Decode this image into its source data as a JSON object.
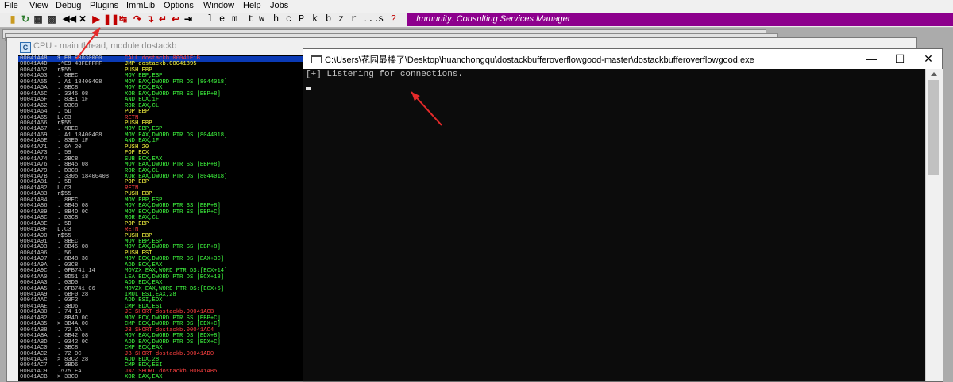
{
  "menu": [
    "File",
    "View",
    "Debug",
    "Plugins",
    "ImmLib",
    "Options",
    "Window",
    "Help",
    "Jobs"
  ],
  "toolbar": {
    "buttons": [
      "open-icon",
      "restart-icon",
      "close-program-icon",
      "window-icon",
      "rewind-icon",
      "close-icon",
      "run-icon",
      "pause-icon",
      "step-into-icon",
      "step-over-icon",
      "trace-into-icon",
      "trace-over-icon",
      "execute-till-return-icon",
      "go-to-icon"
    ],
    "letters": [
      "l",
      "e",
      "m",
      "t",
      "w",
      "h",
      "c",
      "P",
      "k",
      "b",
      "z",
      "r",
      "...",
      "s",
      "?"
    ],
    "banner": "Immunity: Consulting Services Manager",
    "banner_color": "#8d008d"
  },
  "cpu_window": {
    "title": "CPU - main thread, module dostackb",
    "rows": [
      {
        "addr": "00041A48",
        "mark": "$",
        "hex": "E8 E3030000",
        "ins": "CALL dostackb.00041E1B",
        "color": "#ff4040",
        "sel": true
      },
      {
        "addr": "00041A4D",
        "mark": ".^",
        "hex": "E9 43FEFFFF",
        "ins": "JMP dostackb.00041895",
        "color": "#ffff40"
      },
      {
        "addr": "00041A52",
        "mark": "r$",
        "hex": "55",
        "ins": "PUSH EBP",
        "color": "#ffff40"
      },
      {
        "addr": "00041A53",
        "mark": ".",
        "hex": "8BEC",
        "ins": "MOV EBP,ESP",
        "color": "#40ff40"
      },
      {
        "addr": "00041A55",
        "mark": ".",
        "hex": "A1 18400408",
        "ins": "MOV EAX,DWORD PTR DS:[8044018]",
        "color": "#40ff40"
      },
      {
        "addr": "00041A5A",
        "mark": ".",
        "hex": "8BC8",
        "ins": "MOV ECX,EAX",
        "color": "#40ff40"
      },
      {
        "addr": "00041A5C",
        "mark": ".",
        "hex": "3345 08",
        "ins": "XOR EAX,DWORD PTR SS:[EBP+8]",
        "color": "#40ff40"
      },
      {
        "addr": "00041A5F",
        "mark": ".",
        "hex": "83E1 1F",
        "ins": "AND ECX,1F",
        "color": "#40ff40"
      },
      {
        "addr": "00041A62",
        "mark": ".",
        "hex": "D3C8",
        "ins": "ROR EAX,CL",
        "color": "#40ff40"
      },
      {
        "addr": "00041A64",
        "mark": ".",
        "hex": "5D",
        "ins": "POP EBP",
        "color": "#ffff40"
      },
      {
        "addr": "00041A65",
        "mark": "L.",
        "hex": "C3",
        "ins": "RETN",
        "color": "#ff4040"
      },
      {
        "addr": "00041A66",
        "mark": "r$",
        "hex": "55",
        "ins": "PUSH EBP",
        "color": "#ffff40"
      },
      {
        "addr": "00041A67",
        "mark": ".",
        "hex": "8BEC",
        "ins": "MOV EBP,ESP",
        "color": "#40ff40"
      },
      {
        "addr": "00041A69",
        "mark": ".",
        "hex": "A1 18400408",
        "ins": "MOV EAX,DWORD PTR DS:[8044018]",
        "color": "#40ff40"
      },
      {
        "addr": "00041A6E",
        "mark": ".",
        "hex": "83E0 1F",
        "ins": "AND EAX,1F",
        "color": "#40ff40"
      },
      {
        "addr": "00041A71",
        "mark": ".",
        "hex": "6A 20",
        "ins": "PUSH 20",
        "color": "#ffff40"
      },
      {
        "addr": "00041A73",
        "mark": ".",
        "hex": "59",
        "ins": "POP ECX",
        "color": "#ffff40"
      },
      {
        "addr": "00041A74",
        "mark": ".",
        "hex": "2BC8",
        "ins": "SUB ECX,EAX",
        "color": "#40ff40"
      },
      {
        "addr": "00041A76",
        "mark": ".",
        "hex": "8B45 08",
        "ins": "MOV EAX,DWORD PTR SS:[EBP+8]",
        "color": "#40ff40"
      },
      {
        "addr": "00041A79",
        "mark": ".",
        "hex": "D3C8",
        "ins": "ROR EAX,CL",
        "color": "#40ff40"
      },
      {
        "addr": "00041A7B",
        "mark": ".",
        "hex": "3305 18400408",
        "ins": "XOR EAX,DWORD PTR DS:[8044018]",
        "color": "#40ff40"
      },
      {
        "addr": "00041A81",
        "mark": ".",
        "hex": "5D",
        "ins": "POP EBP",
        "color": "#ffff40"
      },
      {
        "addr": "00041A82",
        "mark": "L.",
        "hex": "C3",
        "ins": "RETN",
        "color": "#ff4040"
      },
      {
        "addr": "00041A83",
        "mark": "r$",
        "hex": "55",
        "ins": "PUSH EBP",
        "color": "#ffff40"
      },
      {
        "addr": "00041A84",
        "mark": ".",
        "hex": "8BEC",
        "ins": "MOV EBP,ESP",
        "color": "#40ff40"
      },
      {
        "addr": "00041A86",
        "mark": ".",
        "hex": "8B45 08",
        "ins": "MOV EAX,DWORD PTR SS:[EBP+8]",
        "color": "#40ff40"
      },
      {
        "addr": "00041A89",
        "mark": ".",
        "hex": "8B4D 0C",
        "ins": "MOV ECX,DWORD PTR SS:[EBP+C]",
        "color": "#40ff40"
      },
      {
        "addr": "00041A8C",
        "mark": ".",
        "hex": "D3C8",
        "ins": "ROR EAX,CL",
        "color": "#40ff40"
      },
      {
        "addr": "00041A8E",
        "mark": ".",
        "hex": "5D",
        "ins": "POP EBP",
        "color": "#ffff40"
      },
      {
        "addr": "00041A8F",
        "mark": "L.",
        "hex": "C3",
        "ins": "RETN",
        "color": "#ff4040"
      },
      {
        "addr": "00041A90",
        "mark": "r$",
        "hex": "55",
        "ins": "PUSH EBP",
        "color": "#ffff40"
      },
      {
        "addr": "00041A91",
        "mark": ".",
        "hex": "8BEC",
        "ins": "MOV EBP,ESP",
        "color": "#40ff40"
      },
      {
        "addr": "00041A93",
        "mark": ".",
        "hex": "8B45 08",
        "ins": "MOV EAX,DWORD PTR SS:[EBP+8]",
        "color": "#40ff40"
      },
      {
        "addr": "00041A96",
        "mark": ".",
        "hex": "56",
        "ins": "PUSH ESI",
        "color": "#ffff40"
      },
      {
        "addr": "00041A97",
        "mark": ".",
        "hex": "8B48 3C",
        "ins": "MOV ECX,DWORD PTR DS:[EAX+3C]",
        "color": "#40ff40"
      },
      {
        "addr": "00041A9A",
        "mark": ".",
        "hex": "03C8",
        "ins": "ADD ECX,EAX",
        "color": "#40ff40"
      },
      {
        "addr": "00041A9C",
        "mark": ".",
        "hex": "0FB741 14",
        "ins": "MOVZX EAX,WORD PTR DS:[ECX+14]",
        "color": "#40ff40"
      },
      {
        "addr": "00041AA0",
        "mark": ".",
        "hex": "8D51 18",
        "ins": "LEA EDX,DWORD PTR DS:[ECX+18]",
        "color": "#40ff40"
      },
      {
        "addr": "00041AA3",
        "mark": ".",
        "hex": "03D0",
        "ins": "ADD EDX,EAX",
        "color": "#40ff40"
      },
      {
        "addr": "00041AA5",
        "mark": ".",
        "hex": "0FB741 06",
        "ins": "MOVZX EAX,WORD PTR DS:[ECX+6]",
        "color": "#40ff40"
      },
      {
        "addr": "00041AA9",
        "mark": ".",
        "hex": "6BF0 28",
        "ins": "IMUL ESI,EAX,28",
        "color": "#40ff40"
      },
      {
        "addr": "00041AAC",
        "mark": ".",
        "hex": "03F2",
        "ins": "ADD ESI,EDX",
        "color": "#40ff40"
      },
      {
        "addr": "00041AAE",
        "mark": ".",
        "hex": "3BD6",
        "ins": "CMP EDX,ESI",
        "color": "#40ff40"
      },
      {
        "addr": "00041AB0",
        "mark": ".",
        "hex": "74 19",
        "ins": "JE SHORT dostackb.00041ACB",
        "color": "#ff4040"
      },
      {
        "addr": "00041AB2",
        "mark": ".",
        "hex": "8B4D 0C",
        "ins": "MOV ECX,DWORD PTR SS:[EBP+C]",
        "color": "#40ff40"
      },
      {
        "addr": "00041AB5",
        "mark": ">",
        "hex": "3B4A 0C",
        "ins": "CMP ECX,DWORD PTR DS:[EDX+C]",
        "color": "#40ff40"
      },
      {
        "addr": "00041AB8",
        "mark": ".",
        "hex": "72 0A",
        "ins": "JB SHORT dostackb.00041AC4",
        "color": "#ff4040"
      },
      {
        "addr": "00041ABA",
        "mark": ".",
        "hex": "8B42 08",
        "ins": "MOV EAX,DWORD PTR DS:[EDX+8]",
        "color": "#40ff40"
      },
      {
        "addr": "00041ABD",
        "mark": ".",
        "hex": "0342 0C",
        "ins": "ADD EAX,DWORD PTR DS:[EDX+C]",
        "color": "#40ff40"
      },
      {
        "addr": "00041AC0",
        "mark": ".",
        "hex": "3BC8",
        "ins": "CMP ECX,EAX",
        "color": "#40ff40"
      },
      {
        "addr": "00041AC2",
        "mark": ".",
        "hex": "72 0C",
        "ins": "JB SHORT dostackb.00041AD0",
        "color": "#ff4040"
      },
      {
        "addr": "00041AC4",
        "mark": ">",
        "hex": "83C2 28",
        "ins": "ADD EDX,28",
        "color": "#40ff40"
      },
      {
        "addr": "00041AC7",
        "mark": ".",
        "hex": "3BD6",
        "ins": "CMP EDX,ESI",
        "color": "#40ff40"
      },
      {
        "addr": "00041AC9",
        "mark": ".^",
        "hex": "75 EA",
        "ins": "JNZ SHORT dostackb.00041AB5",
        "color": "#ff4040"
      },
      {
        "addr": "00041ACB",
        "mark": ">",
        "hex": "33C0",
        "ins": "XOR EAX,EAX",
        "color": "#40ff40"
      }
    ]
  },
  "console_window": {
    "title": "C:\\Users\\花园最棒了\\Desktop\\huanchongqu\\dostackbufferoverflowgood-master\\dostackbufferoverflowgood.exe",
    "output": "[+] Listening for connections.",
    "minimize": "—",
    "maximize": "☐",
    "close": "✕"
  },
  "annotation_color": "#e52a2a"
}
